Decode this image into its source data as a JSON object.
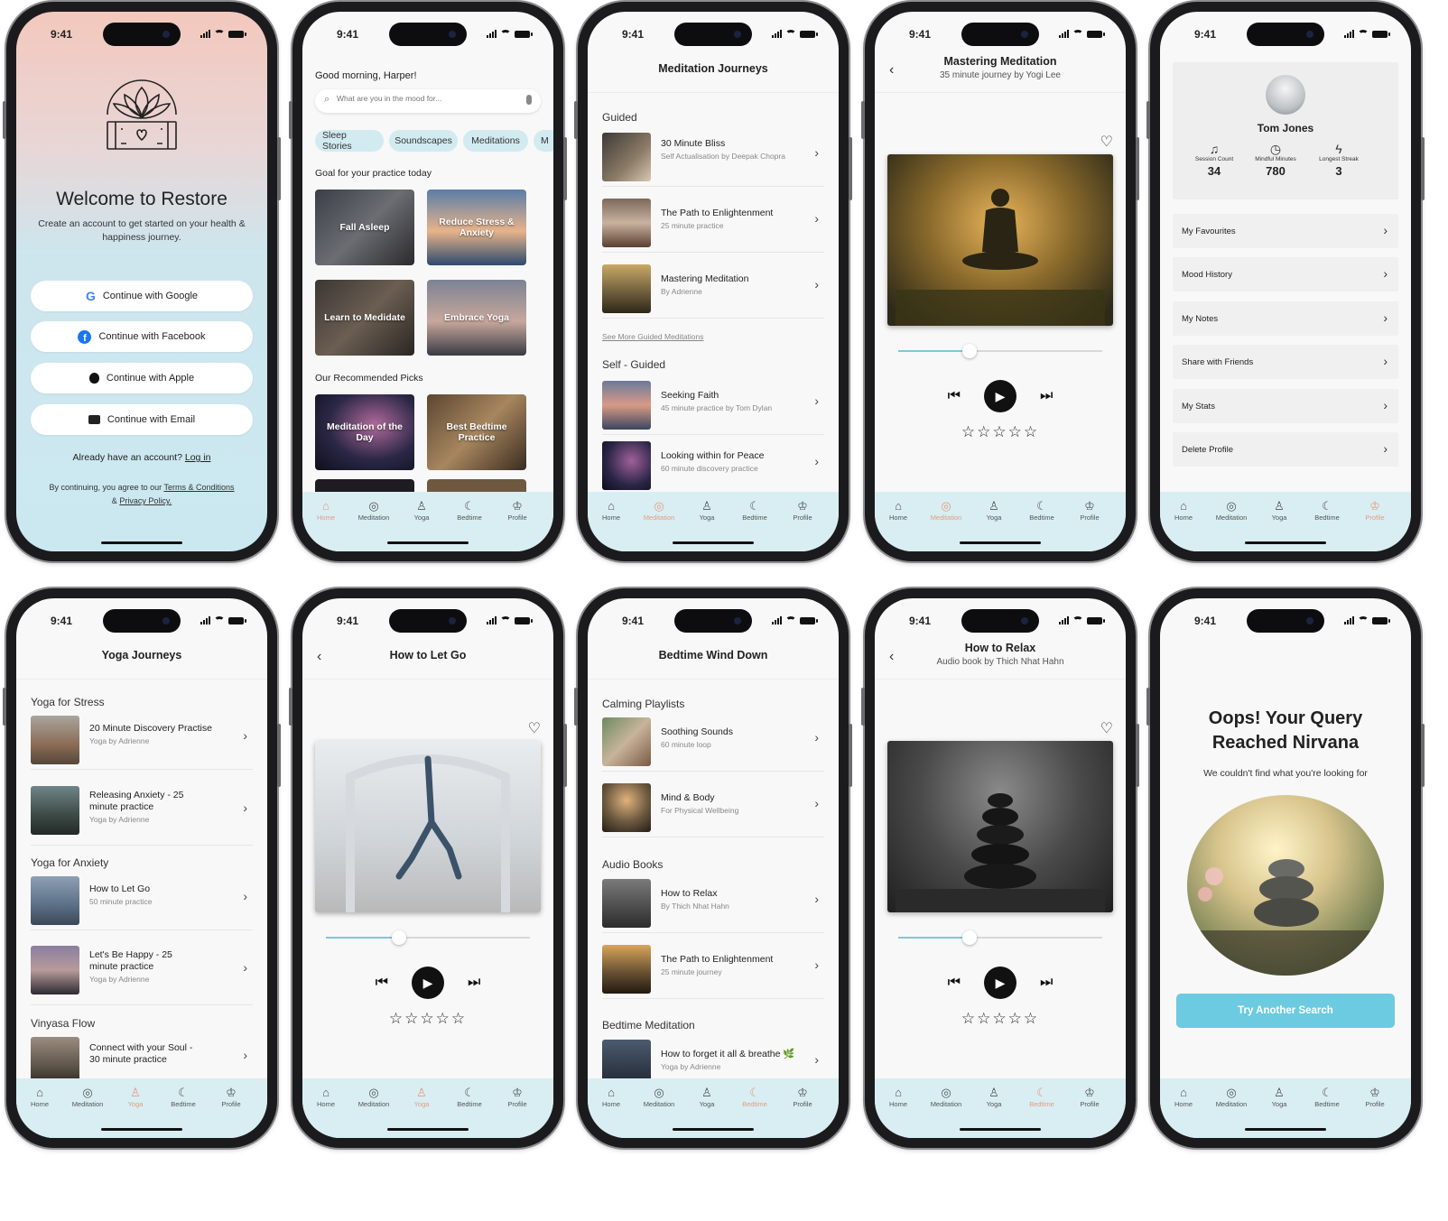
{
  "status_time": "9:41",
  "tabs": [
    "Home",
    "Meditation",
    "Yoga",
    "Bedtime",
    "Profile"
  ],
  "colors": {
    "accent": "#e79a82",
    "tabbar": "#d8eef2",
    "primary_button": "#6ccbe0"
  },
  "welcome": {
    "title": "Welcome to Restore",
    "subtitle": "Create an account to get started on your health & happiness journey.",
    "buttons": [
      {
        "label": "Continue with Google",
        "icon": "google-icon"
      },
      {
        "label": "Continue with Facebook",
        "icon": "facebook-icon"
      },
      {
        "label": "Continue with Apple",
        "icon": "apple-icon"
      },
      {
        "label": "Continue with Email",
        "icon": "mail-icon"
      }
    ],
    "login_prompt": "Already have an account?",
    "login_link": "Log in",
    "terms_prefix": "By continuing, you agree to our",
    "terms_link": "Terms & Conditions",
    "amp": "&",
    "privacy_link": "Privacy Policy."
  },
  "home": {
    "greeting": "Good morning, Harper!",
    "search_placeholder": "What are you in the mood for...",
    "chips": [
      "Sleep Stories",
      "Soundscapes",
      "Meditations",
      "M"
    ],
    "goal_title": "Goal for your practice today",
    "goal_tiles": [
      "Fall Asleep",
      "Reduce Stress & Anxiety",
      "Learn to Medidate",
      "Embrace Yoga"
    ],
    "rec_title": "Our Recommended Picks",
    "rec_tiles": [
      "Meditation of the Day",
      "Best Bedtime Practice"
    ]
  },
  "meditation": {
    "title": "Meditation Journeys",
    "guided_title": "Guided",
    "guided": [
      {
        "title": "30 Minute Bliss",
        "sub": "Self Actualisation by Deepak Chopra"
      },
      {
        "title": "The Path to Enlightenment",
        "sub": "25 minute practice"
      },
      {
        "title": "Mastering Meditation",
        "sub": "By Adrienne"
      }
    ],
    "see_more": "See More Guided Meditations",
    "self_title": "Self - Guided",
    "self": [
      {
        "title": "Seeking Faith",
        "sub": "45 minute practice by Tom Dylan"
      },
      {
        "title": "Looking within for Peace",
        "sub": "60 minute discovery practice"
      }
    ]
  },
  "player_mm": {
    "title": "Mastering Meditation",
    "sub": "35 minute journey by Yogi Lee",
    "progress": 0.35,
    "rating_stars": "☆☆☆☆☆"
  },
  "profile": {
    "name": "Tom Jones",
    "stats": [
      {
        "label": "Session Count",
        "value": "34",
        "icon": "headphones-icon"
      },
      {
        "label": "Mindful Minutes",
        "value": "780",
        "icon": "clock-icon"
      },
      {
        "label": "Longest Streak",
        "value": "3",
        "icon": "lightning-icon"
      }
    ],
    "items": [
      "My Favourites",
      "Mood History",
      "My Notes",
      "Share with Friends",
      "My Stats",
      "Delete Profile"
    ]
  },
  "yoga": {
    "title": "Yoga Journeys",
    "stress_title": "Yoga for Stress",
    "stress": [
      {
        "title": "20 Minute Discovery Practise",
        "sub": "Yoga by Adrienne"
      },
      {
        "title": "Releasing Anxiety - 25 minute practice",
        "sub": "Yoga by Adrienne"
      }
    ],
    "anxiety_title": "Yoga for Anxiety",
    "anxiety": [
      {
        "title": "How to Let Go",
        "sub": "50 minute practice"
      },
      {
        "title": "Let's Be Happy - 25 minute practice",
        "sub": "Yoga by Adrienne"
      }
    ],
    "vinyasa_title": "Vinyasa Flow",
    "vinyasa": [
      {
        "title": "Connect with your Soul - 30 minute practice",
        "sub": ""
      }
    ]
  },
  "player_letgo": {
    "title": "How to Let Go",
    "progress": 0.36,
    "rating_stars": "☆☆☆☆☆"
  },
  "bedtime": {
    "title": "Bedtime Wind Down",
    "calm_title": "Calming Playlists",
    "calm": [
      {
        "title": "Soothing Sounds",
        "sub": "60 minute loop"
      },
      {
        "title": "Mind & Body",
        "sub": "For Physical Wellbeing"
      }
    ],
    "audio_title": "Audio Books",
    "audio": [
      {
        "title": "How to Relax",
        "sub": "By Thich Nhat Hahn"
      },
      {
        "title": "The Path to Enlightenment",
        "sub": "25 minute journey"
      }
    ],
    "bedmed_title": "Bedtime Meditation",
    "bedmed": [
      {
        "title": "How to forget it all & breathe 🌿",
        "sub": "Yoga by Adrienne"
      }
    ]
  },
  "player_relax": {
    "title": "How to Relax",
    "sub": "Audio book by Thich Nhat Hahn",
    "progress": 0.35,
    "rating_stars": "☆☆☆☆☆"
  },
  "notfound": {
    "title": "Oops! Your Query Reached Nirvana",
    "sub": "We couldn't find what you're looking for",
    "button": "Try Another Search"
  }
}
